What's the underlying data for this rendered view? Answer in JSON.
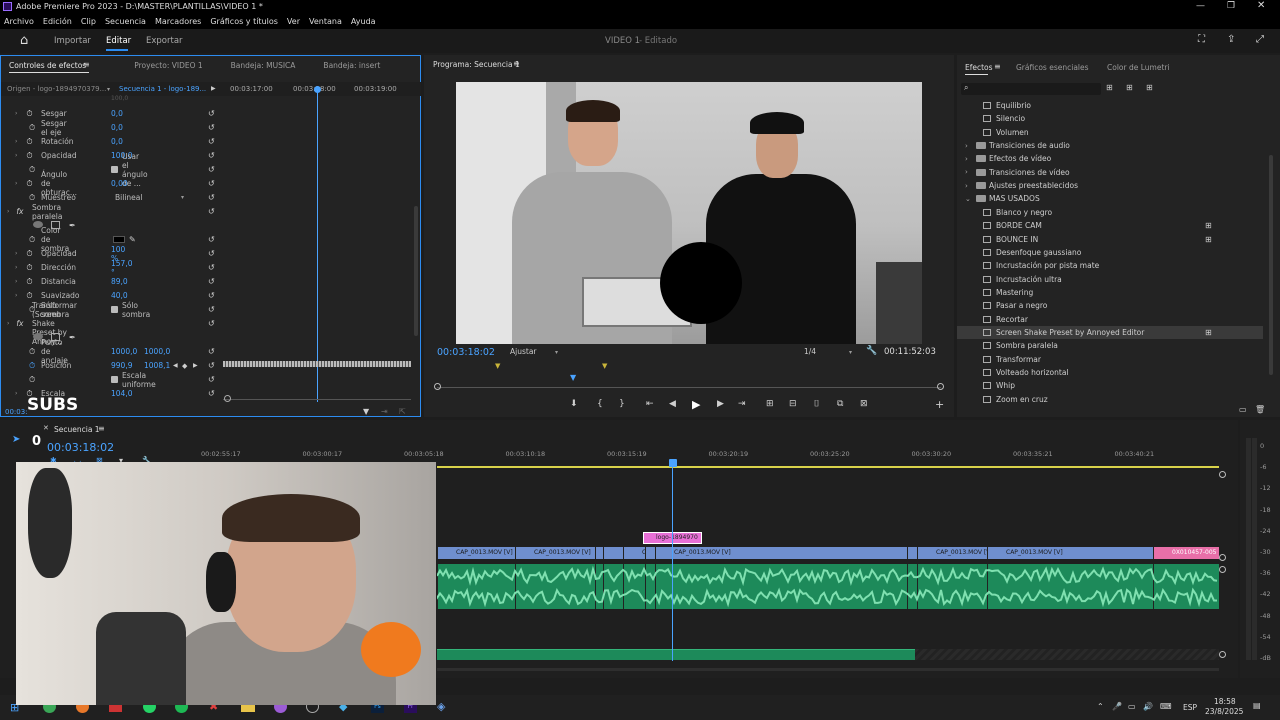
{
  "app": {
    "title": "Adobe Premiere Pro 2023 - D:\\MASTER\\PLANTILLAS\\VIDEO 1 *",
    "menu": [
      "Archivo",
      "Edición",
      "Clip",
      "Secuencia",
      "Marcadores",
      "Gráficos y títulos",
      "Ver",
      "Ventana",
      "Ayuda"
    ],
    "workspace": {
      "import": "Importar",
      "edit": "Editar",
      "export": "Exportar",
      "project_title": "VIDEO 1",
      "status": "- Editado"
    }
  },
  "effect_controls": {
    "tabs": [
      "Controles de efectos",
      "Proyecto: VIDEO 1",
      "Bandeja: MUSICA",
      "Bandeja: insert"
    ],
    "source": "Origen - logo-1894970379...",
    "sequence": "Secuencia 1 - logo-189...",
    "timecodes": [
      "00:03:17:00",
      "00:03:18:00",
      "00:03:19:00"
    ],
    "top_value": "100,0",
    "rows": [
      {
        "label": "Sesgar",
        "value": "0,0"
      },
      {
        "label": "Sesgar el eje",
        "value": "0,0"
      },
      {
        "label": "Rotación",
        "value": "0,0"
      },
      {
        "label": "Opacidad",
        "value": "100,0"
      },
      {
        "label": "",
        "value": "Usar el ángulo de ..."
      },
      {
        "label": "Ángulo de obturac...",
        "value": "0,00"
      },
      {
        "label": "Muestreo",
        "value": "Bilineal"
      },
      {
        "label": "Sombra paralela",
        "value": ""
      },
      {
        "label": "",
        "value": ""
      },
      {
        "label": "Color de sombra",
        "value": ""
      },
      {
        "label": "Opacidad",
        "value": "100 %"
      },
      {
        "label": "Dirección",
        "value": "157,0 °"
      },
      {
        "label": "Distancia",
        "value": "89,0"
      },
      {
        "label": "Suavizado",
        "value": "40,0"
      },
      {
        "label": "Sólo sombra",
        "value": "Sólo sombra"
      },
      {
        "label": "Transformar (Screen Shake Preset by Annoy...",
        "value": ""
      },
      {
        "label": "",
        "value": ""
      },
      {
        "label": "Punto de anclaje",
        "value": "1000,0",
        "value2": "1000,0"
      },
      {
        "label": "Posición",
        "value": "990,9",
        "value2": "1008,1"
      },
      {
        "label": "",
        "value": "Escala uniforme"
      },
      {
        "label": "Escala",
        "value": "104,0"
      }
    ],
    "current_time": "00:03:"
  },
  "program": {
    "tab": "Programa: Secuencia 1",
    "timecode": "00:03:18:02",
    "fit": "Ajustar",
    "resolution": "1/4",
    "duration": "00:11:52:03"
  },
  "effects": {
    "tabs": [
      "Efectos",
      "Gráficos esenciales",
      "Color de Lumetri"
    ],
    "items": [
      {
        "label": "Equilibrio",
        "type": "fx",
        "indent": 2
      },
      {
        "label": "Silencio",
        "type": "fx",
        "indent": 2
      },
      {
        "label": "Volumen",
        "type": "fx",
        "indent": 2
      },
      {
        "label": "Transiciones de audio",
        "type": "folder",
        "indent": 1
      },
      {
        "label": "Efectos de vídeo",
        "type": "folder",
        "indent": 1
      },
      {
        "label": "Transiciones de vídeo",
        "type": "folder",
        "indent": 1
      },
      {
        "label": "Ajustes preestablecidos",
        "type": "folder",
        "indent": 1
      },
      {
        "label": "MAS USADOS",
        "type": "folder-open",
        "indent": 1
      },
      {
        "label": "Blanco y negro",
        "type": "fx",
        "indent": 2
      },
      {
        "label": "BORDE CAM",
        "type": "fx",
        "indent": 2,
        "badge": true
      },
      {
        "label": "BOUNCE IN",
        "type": "fx",
        "indent": 2,
        "badge": true
      },
      {
        "label": "Desenfoque gaussiano",
        "type": "fx",
        "indent": 2
      },
      {
        "label": "Incrustación por pista mate",
        "type": "fx",
        "indent": 2
      },
      {
        "label": "Incrustación ultra",
        "type": "fx",
        "indent": 2
      },
      {
        "label": "Mastering",
        "type": "fx",
        "indent": 2
      },
      {
        "label": "Pasar a negro",
        "type": "fx",
        "indent": 2
      },
      {
        "label": "Recortar",
        "type": "fx",
        "indent": 2
      },
      {
        "label": "Screen Shake Preset by Annoyed Editor",
        "type": "fx",
        "indent": 2,
        "badge": true,
        "selected": true
      },
      {
        "label": "Sombra paralela",
        "type": "fx",
        "indent": 2
      },
      {
        "label": "Transformar",
        "type": "fx",
        "indent": 2
      },
      {
        "label": "Volteado horizontal",
        "type": "fx",
        "indent": 2
      },
      {
        "label": "Whip",
        "type": "fx",
        "indent": 2
      },
      {
        "label": "Zoom en cruz",
        "type": "fx",
        "indent": 2
      }
    ]
  },
  "timeline": {
    "tab": "Secuencia 1",
    "timecode": "00:03:18:02",
    "ruler": [
      "00:02:55:17",
      "00:03:00:17",
      "00:03:05:18",
      "00:03:10:18",
      "00:03:15:19",
      "00:03:20:19",
      "00:03:25:20",
      "00:03:30:20",
      "00:03:35:21",
      "00:03:40:21"
    ],
    "graphic_clip": "logo-1894970",
    "video_clips": [
      {
        "label": "CAP_0013.MOV [V]"
      },
      {
        "label": "CAP_0013.MOV [V]"
      },
      {
        "label": ""
      },
      {
        "label": ""
      },
      {
        "label": "CAP_0013.MO"
      },
      {
        "label": ""
      },
      {
        "label": "CAP_0013.MOV [V]"
      },
      {
        "label": ""
      },
      {
        "label": "CAP_0013.MOV [V]"
      },
      {
        "label": "CAP_0013.MOV [V]"
      },
      {
        "label": "0X010457-005"
      }
    ],
    "meter_ticks": [
      "0",
      "-6",
      "-12",
      "-18",
      "-24",
      "-30",
      "-36",
      "-42",
      "-48",
      "-54",
      "-dB"
    ]
  },
  "webcam": {
    "overlay_text": "SUBS",
    "small_number": "0"
  },
  "taskbar": {
    "lang": "ESP",
    "time": "18:58",
    "date": "23/8/2025"
  },
  "colors": {
    "accent": "#2d8cf0",
    "video_clip": "#6f8fcf",
    "audio_clip": "#1d8a5a",
    "graphic_clip": "#e86fd6",
    "playhead": "#4aa3ff"
  }
}
